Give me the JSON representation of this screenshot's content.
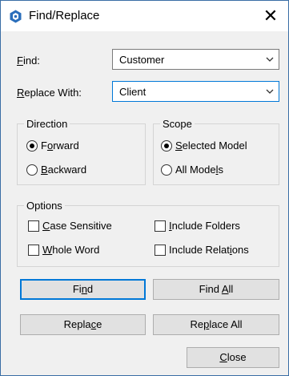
{
  "window": {
    "title": "Find/Replace",
    "close_glyph": "✕",
    "app_icon": "gear-hex-icon",
    "accent": "#0078d7",
    "icon_color": "#2a6ebb"
  },
  "fields": {
    "find": {
      "label_u": "F",
      "label_rest": "ind:",
      "value": "Customer"
    },
    "replace": {
      "label_u": "R",
      "label_rest": "eplace With:",
      "value": "Client"
    }
  },
  "direction": {
    "title": "Direction",
    "forward": {
      "pre": "F",
      "u": "o",
      "post": "rward",
      "selected": true
    },
    "backward": {
      "pre": "",
      "u": "B",
      "post": "ackward",
      "selected": false
    }
  },
  "scope": {
    "title": "Scope",
    "selected_model": {
      "pre": "",
      "u": "S",
      "post": "elected Model",
      "selected": true
    },
    "all_models": {
      "pre": "All Mode",
      "u": "l",
      "post": "s",
      "selected": false
    }
  },
  "options": {
    "title": "Options",
    "case_sensitive": {
      "pre": "",
      "u": "C",
      "post": "ase Sensitive",
      "checked": false
    },
    "include_folders": {
      "pre": "",
      "u": "I",
      "post": "nclude Folders",
      "checked": false
    },
    "whole_word": {
      "pre": "",
      "u": "W",
      "post": "hole Word",
      "checked": false
    },
    "include_relations": {
      "pre": "Include Relat",
      "u": "i",
      "post": "ons",
      "checked": false
    }
  },
  "buttons": {
    "find": {
      "pre": "Fi",
      "u": "n",
      "post": "d"
    },
    "find_all": {
      "pre": "Find ",
      "u": "A",
      "post": "ll"
    },
    "replace": {
      "pre": "Repla",
      "u": "c",
      "post": "e"
    },
    "replace_all": {
      "pre": "Re",
      "u": "p",
      "post": "lace All"
    },
    "close": {
      "pre": "",
      "u": "C",
      "post": "lose"
    }
  }
}
